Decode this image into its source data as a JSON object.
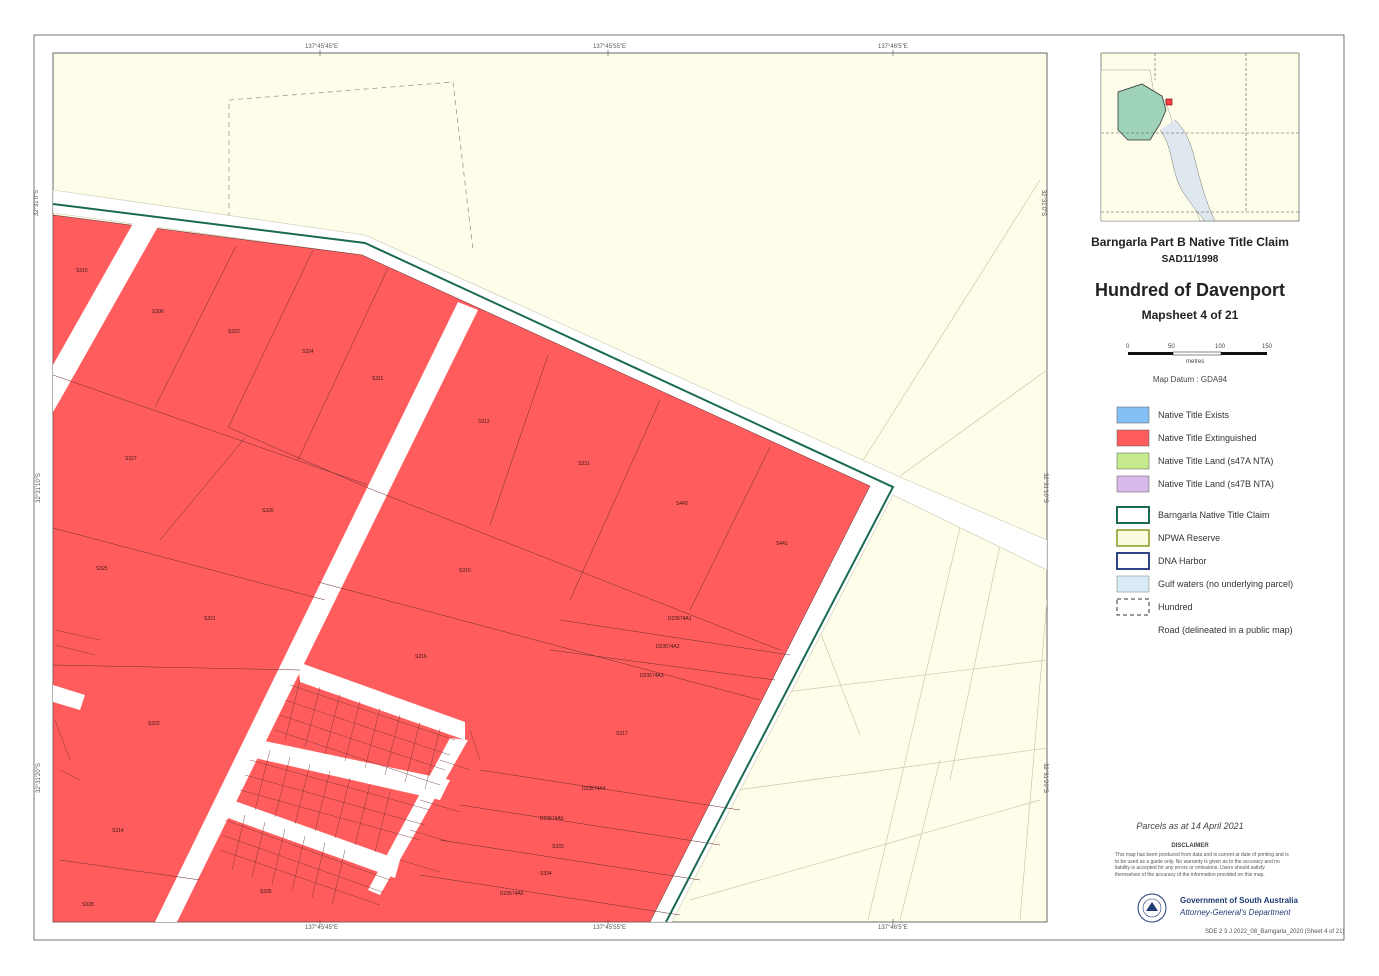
{
  "panel": {
    "title": "Barngarla Part B Native Title Claim",
    "claim_no": "SAD11/1998",
    "hundred": "Hundred of Davenport",
    "mapsheet": "Mapsheet 4 of 21",
    "scale_ticks": [
      "0",
      "50",
      "100",
      "150"
    ],
    "scale_unit": "metres",
    "datum": "Map Datum : GDA94",
    "parcels_date": "Parcels as at 14 April 2021",
    "disclaimer_heading": "DISCLAIMER",
    "disclaimer_text": "This map has been produced from data and is current at date of printing and is to be used as a guide only. No warranty is given as to the accuracy and no liability is accepted for any errors or omissions. Users should satisfy themselves of the accuracy of the information provided on this map.",
    "gov_name": "Government of South Australia",
    "gov_dept": "Attorney-General's Department",
    "footer_ref": "SDE 2 3 J  2022_08_Barngarla_2020 (Sheet 4 of 21)"
  },
  "legend": [
    {
      "label": "Native Title Exists",
      "icon": "blue-fill",
      "color": "#84c0f5"
    },
    {
      "label": "Native Title Extinguished",
      "icon": "red-fill",
      "color": "#ff5d5d"
    },
    {
      "label": "Native Title Land (s47A NTA)",
      "icon": "green-fill",
      "color": "#c7ea8c"
    },
    {
      "label": "Native Title Land (s47B NTA)",
      "icon": "purple-fill",
      "color": "#d9b8ec"
    },
    {
      "label": "Barngarla Native Title Claim",
      "icon": "claim-outline",
      "color": "#1b6a52"
    },
    {
      "label": "NPWA Reserve",
      "icon": "reserve-pattern",
      "color": "#8a9a22"
    },
    {
      "label": "DNA Harbor",
      "icon": "harbor-outline",
      "color": "#1b2f7a"
    },
    {
      "label": "Gulf waters (no underlying parcel)",
      "icon": "gulf-pattern",
      "color": "#9ec9ea"
    },
    {
      "label": "Hundred",
      "icon": "hundred-dashed",
      "color": "#444444"
    },
    {
      "label": "Road (delineated in a public map)",
      "icon": "road-blank",
      "color": "#ffffff"
    }
  ],
  "coords": {
    "top": [
      "137°45'45\"E",
      "137°45'55\"E",
      "137°46'5\"E"
    ],
    "bottom": [
      "137°45'45\"E",
      "137°45'55\"E",
      "137°46'5\"E"
    ],
    "left": [
      "32°31'0\"S",
      "32°31'10\"S",
      "32°31'20\"S"
    ],
    "right": [
      "32°31'0\"S",
      "32°31'10\"S",
      "32°31'20\"S"
    ]
  },
  "parcel_labels": [
    "S315",
    "S306",
    "S323",
    "S324",
    "S311",
    "S327",
    "S326",
    "S312",
    "S331",
    "S440",
    "S441",
    "S325",
    "S321",
    "S310",
    "S316",
    "D23574A1",
    "D23574A2",
    "D23574A3",
    "S322",
    "S317",
    "S314",
    "D23574A4",
    "D23574A5",
    "S333",
    "S334",
    "D23574A6",
    "S335",
    "S328"
  ],
  "colors": {
    "extinguished": "#ff5d5d",
    "background": "#fdfdea",
    "claim_boundary": "#1b6a52",
    "road": "#ffffff",
    "locator_claim": "#9fd3b9"
  }
}
